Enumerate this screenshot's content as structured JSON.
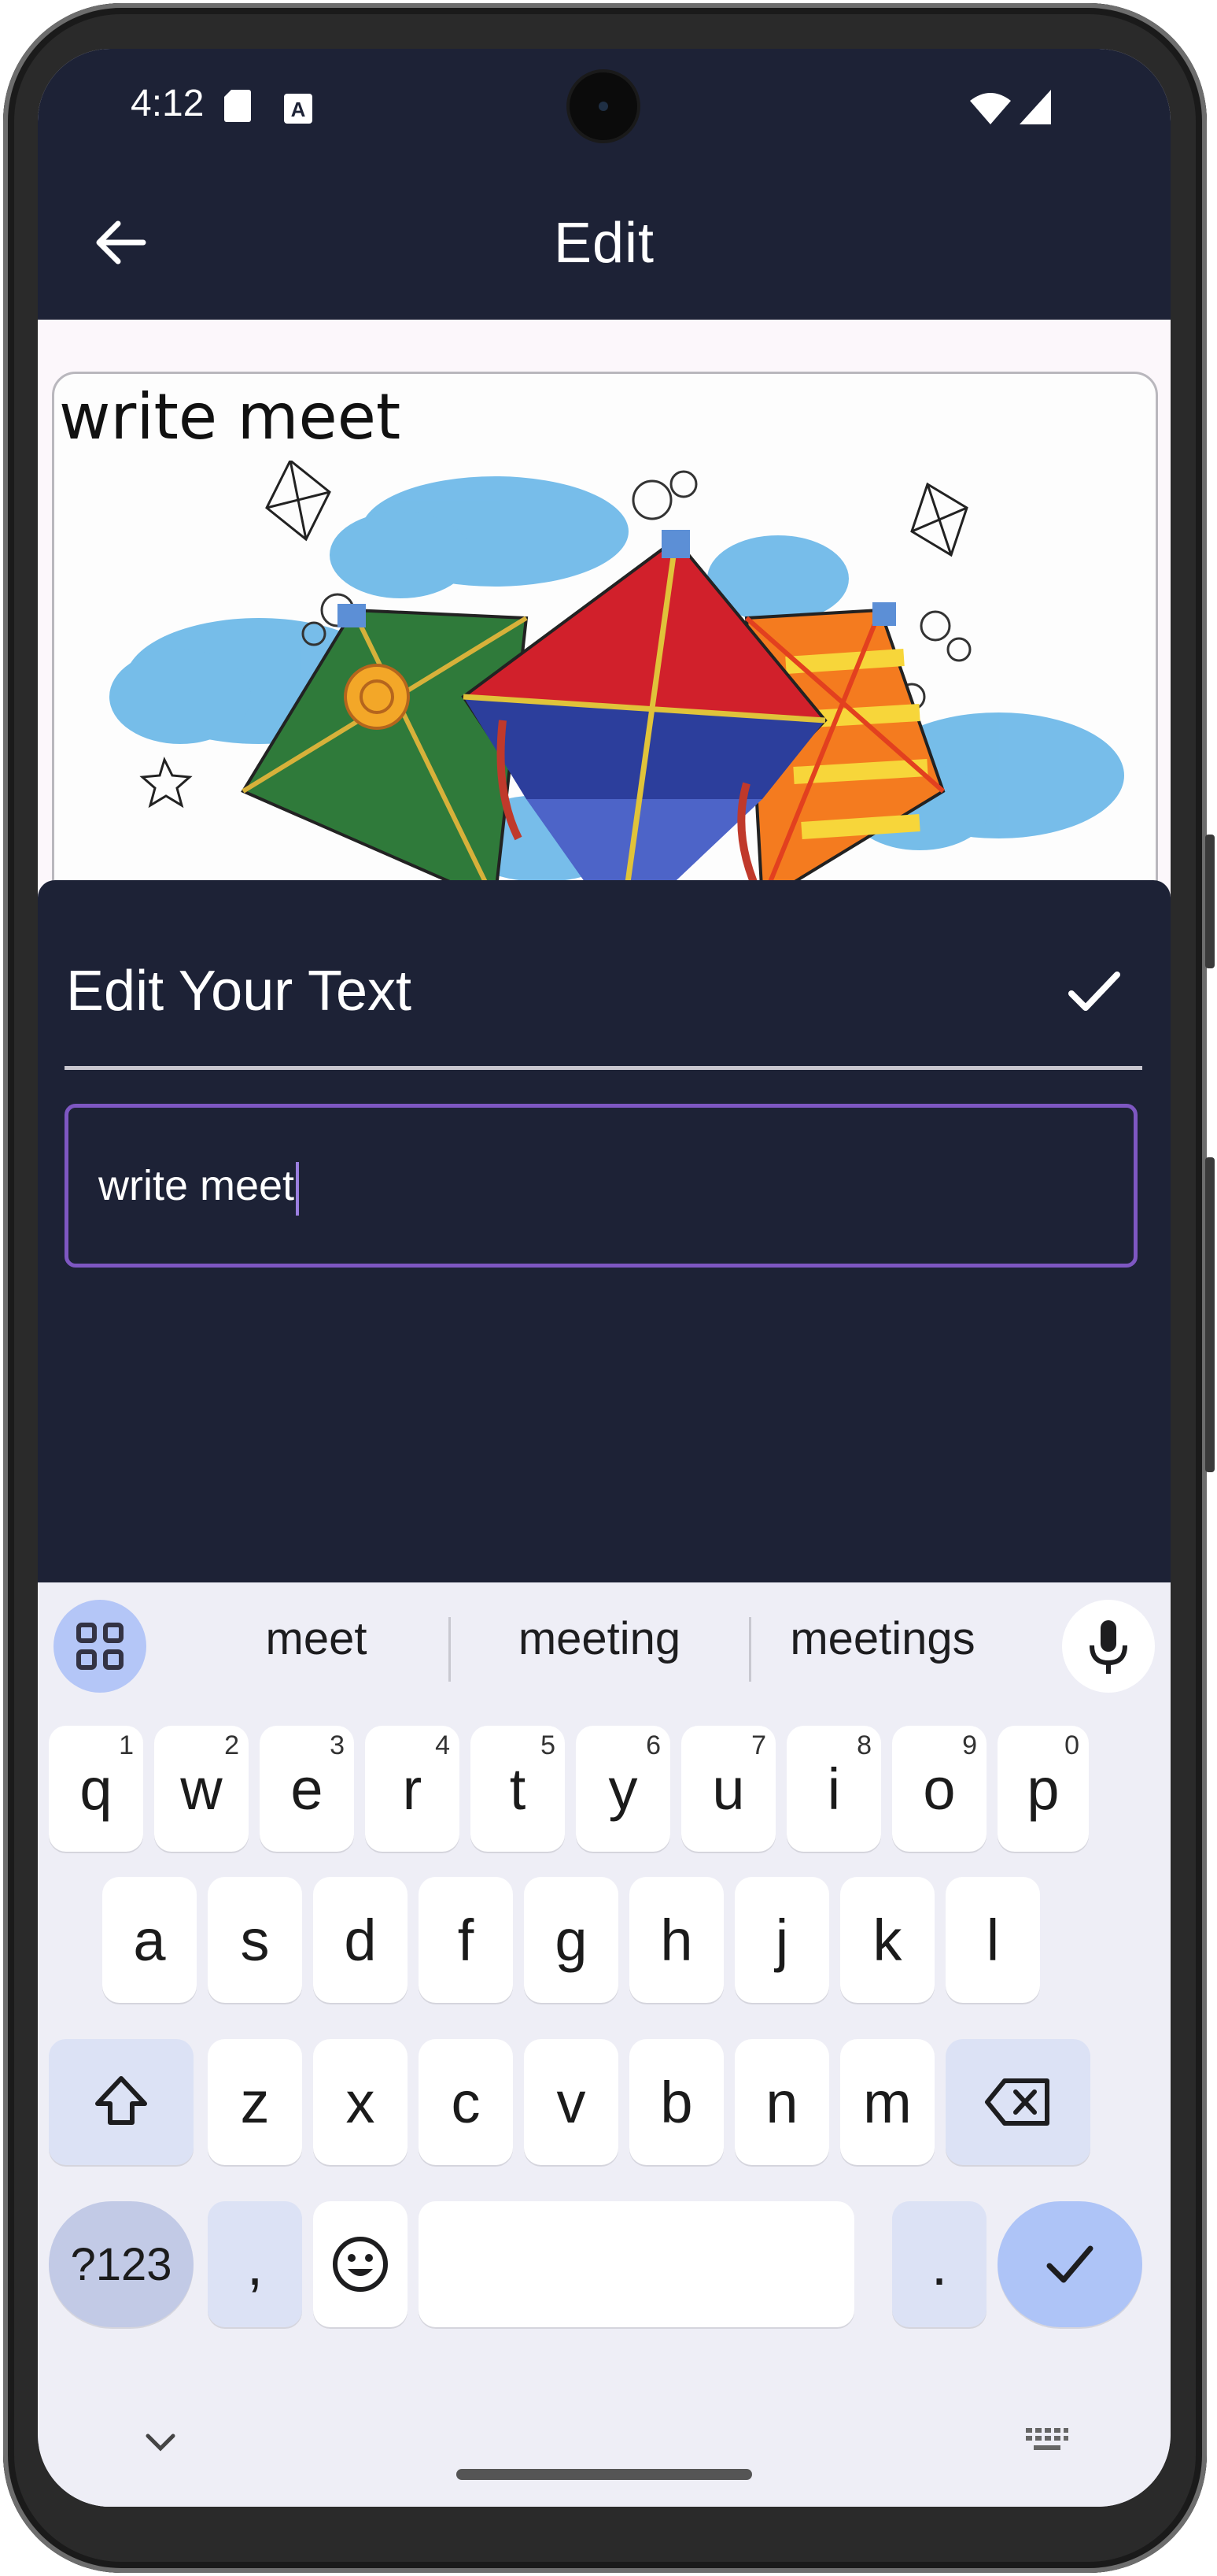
{
  "status_bar": {
    "time": "4:12",
    "icons": [
      "sd-card-icon",
      "keyboard-a-icon",
      "wifi-icon",
      "signal-icon"
    ]
  },
  "app_bar": {
    "title": "Edit",
    "back_icon": "arrow-back-icon"
  },
  "canvas": {
    "overlay_text": "write meet",
    "image_description_icon": "kites-artwork"
  },
  "sheet": {
    "title": "Edit Your Text",
    "confirm_icon": "check-icon",
    "field_value": "write meet"
  },
  "keyboard": {
    "suggestions": [
      "meet",
      "meeting",
      "meetings"
    ],
    "row1": [
      {
        "key": "q",
        "hint": "1"
      },
      {
        "key": "w",
        "hint": "2"
      },
      {
        "key": "e",
        "hint": "3"
      },
      {
        "key": "r",
        "hint": "4"
      },
      {
        "key": "t",
        "hint": "5"
      },
      {
        "key": "y",
        "hint": "6"
      },
      {
        "key": "u",
        "hint": "7"
      },
      {
        "key": "i",
        "hint": "8"
      },
      {
        "key": "o",
        "hint": "9"
      },
      {
        "key": "p",
        "hint": "0"
      }
    ],
    "row2": [
      "a",
      "s",
      "d",
      "f",
      "g",
      "h",
      "j",
      "k",
      "l"
    ],
    "row3": [
      "z",
      "x",
      "c",
      "v",
      "b",
      "n",
      "m"
    ],
    "symbols_label": "?123",
    "comma_label": ",",
    "period_label": ".",
    "colors": {
      "background": "#eeeef6",
      "accent": "#aec4f7"
    }
  },
  "colors": {
    "app_bar": "#1d2236",
    "field_border": "#7e57c2"
  }
}
